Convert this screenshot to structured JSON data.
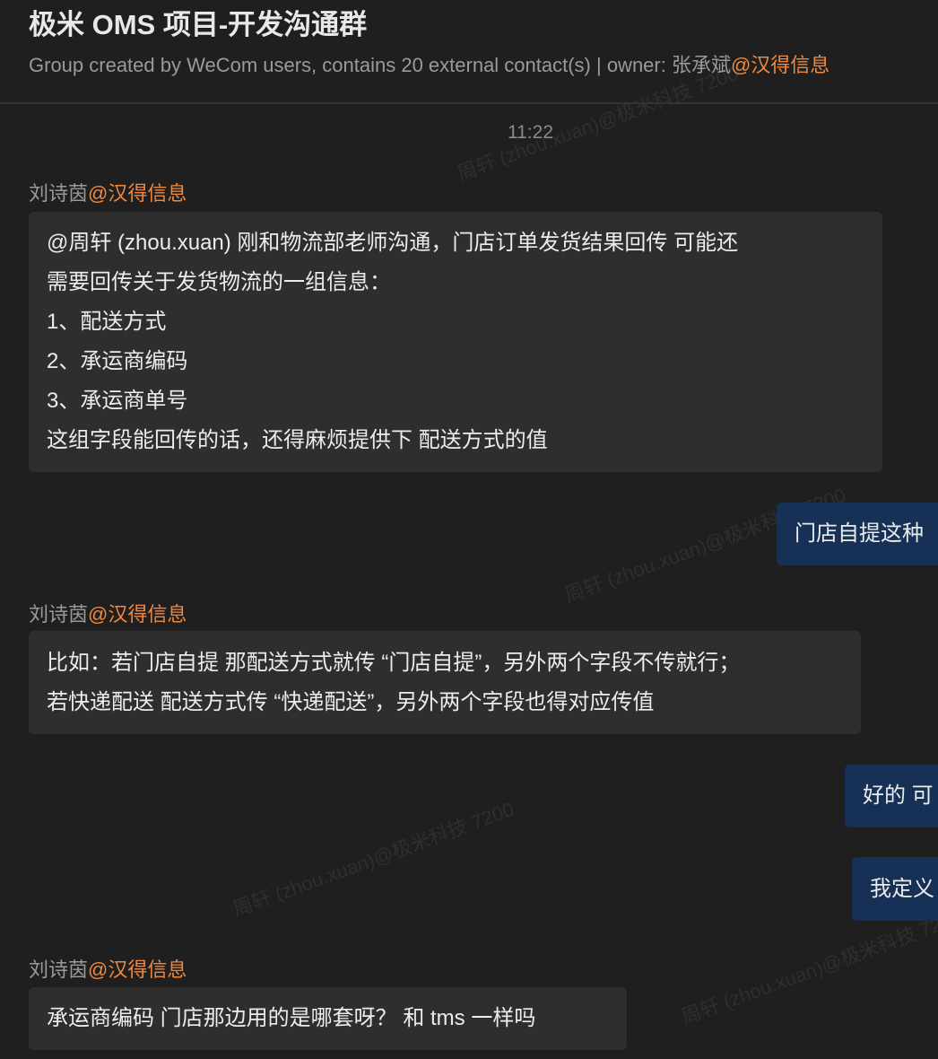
{
  "header": {
    "title": "极米 OMS 项目-开发沟通群",
    "subtitle": "Group created by WeCom users, contains 20 external contact(s) | owner: 张承斌",
    "owner_org": "@汉得信息"
  },
  "chat": {
    "timestamp": "11:22",
    "messages": [
      {
        "sender": "刘诗茵",
        "org": "@汉得信息",
        "lines": [
          " @周轩 (zhou.xuan)  刚和物流部老师沟通，门店订单发货结果回传 可能还",
          "需要回传关于发货物流的一组信息：",
          "1、配送方式",
          "2、承运商编码",
          "3、承运商单号",
          "这组字段能回传的话，还得麻烦提供下 配送方式的值"
        ]
      },
      {
        "mine": true,
        "text": "门店自提这种"
      },
      {
        "sender": "刘诗茵",
        "org": "@汉得信息",
        "lines": [
          "比如：若门店自提 那配送方式就传 “门店自提”，另外两个字段不传就行；",
          "若快递配送 配送方式传 “快递配送”，另外两个字段也得对应传值"
        ]
      },
      {
        "mine": true,
        "text": "好的 可"
      },
      {
        "mine": true,
        "text": "我定义"
      },
      {
        "sender": "刘诗茵",
        "org": "@汉得信息",
        "lines": [
          "承运商编码 门店那边用的是哪套呀？  和 tms 一样吗"
        ]
      }
    ]
  },
  "watermark": "周轩 (zhou.xuan)@极米科技 7200",
  "colors": {
    "background": "#1f1f1f",
    "bubble": "#2e2e2e",
    "my_bubble": "#163056",
    "accent": "#f0883e"
  }
}
